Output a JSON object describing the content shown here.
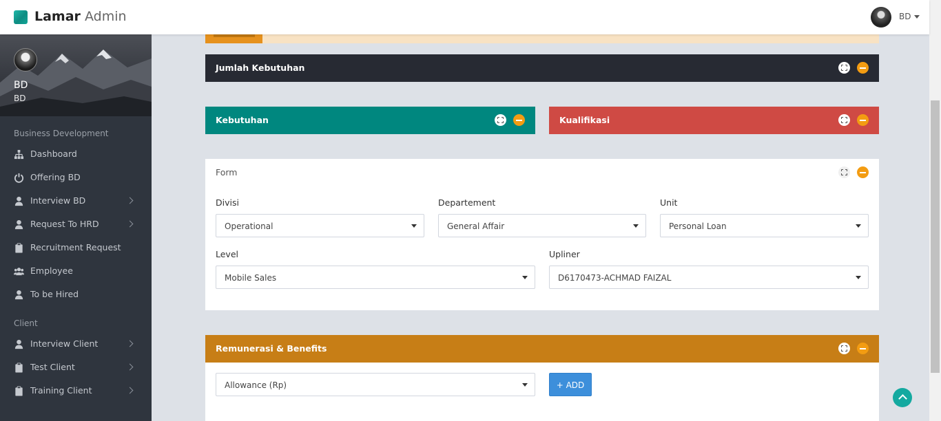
{
  "app": {
    "brand_bold": "Lamar",
    "brand_light": "Admin",
    "user_short": "BD"
  },
  "sidebar": {
    "profile": {
      "name": "BD",
      "role": "BD"
    },
    "sections": [
      {
        "title": "Business Development",
        "items": [
          {
            "label": "Dashboard",
            "icon": "sitemap-icon",
            "has_submenu": false
          },
          {
            "label": "Offering BD",
            "icon": "power-icon",
            "has_submenu": false
          },
          {
            "label": "Interview BD",
            "icon": "user-icon",
            "has_submenu": true
          },
          {
            "label": "Request To HRD",
            "icon": "user-icon",
            "has_submenu": true
          },
          {
            "label": "Recruitment Request",
            "icon": "clipboard-icon",
            "has_submenu": false
          },
          {
            "label": "Employee",
            "icon": "users-icon",
            "has_submenu": false
          },
          {
            "label": "To be Hired",
            "icon": "user-icon",
            "has_submenu": false
          }
        ]
      },
      {
        "title": "Client",
        "items": [
          {
            "label": "Interview Client",
            "icon": "user-icon",
            "has_submenu": true
          },
          {
            "label": "Test Client",
            "icon": "clipboard-icon",
            "has_submenu": true
          },
          {
            "label": "Training Client",
            "icon": "clipboard-icon",
            "has_submenu": true
          }
        ]
      }
    ]
  },
  "panels": {
    "jumlah": {
      "title": "Jumlah Kebutuhan",
      "color": "#272a33"
    },
    "kebutuhan": {
      "title": "Kebutuhan",
      "color": "#00877f"
    },
    "kualifikasi": {
      "title": "Kualifikasi",
      "color": "#cf4a44"
    },
    "form": {
      "title": "Form"
    },
    "remunerasi": {
      "title": "Remunerasi & Benefits",
      "color": "#c77e16"
    }
  },
  "form": {
    "divisi": {
      "label": "Divisi",
      "value": "Operational"
    },
    "departement": {
      "label": "Departement",
      "value": "General Affair"
    },
    "unit": {
      "label": "Unit",
      "value": "Personal Loan"
    },
    "level": {
      "label": "Level",
      "value": "Mobile Sales"
    },
    "upliner": {
      "label": "Upliner",
      "value": "D6170473-ACHMAD FAIZAL"
    }
  },
  "remunerasi": {
    "select_value": "Allowance (Rp)",
    "add_label": "+ ADD"
  }
}
